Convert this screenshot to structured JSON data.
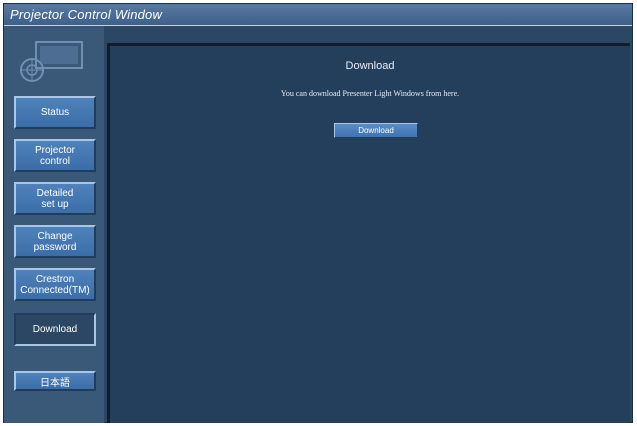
{
  "window": {
    "title": "Projector Control Window"
  },
  "sidebar": {
    "logo_icon": "projector-logo-icon",
    "items": [
      {
        "label": "Status",
        "active": false
      },
      {
        "label": "Projector\ncontrol",
        "active": false
      },
      {
        "label": "Detailed\nset up",
        "active": false
      },
      {
        "label": "Change\npassword",
        "active": false
      },
      {
        "label": "Crestron\nConnected(TM)",
        "active": false
      },
      {
        "label": "Download",
        "active": true
      }
    ],
    "language_button": "日本語"
  },
  "main": {
    "heading": "Download",
    "message": "You can download Presenter Light Windows from here.",
    "download_button": "Download"
  },
  "colors": {
    "window_bg": "#2b4763",
    "sidebar_bg": "#3a5979",
    "content_bg": "#243f5c",
    "button_blue": "#4a7db5",
    "titlebar": "#4a6c96"
  }
}
